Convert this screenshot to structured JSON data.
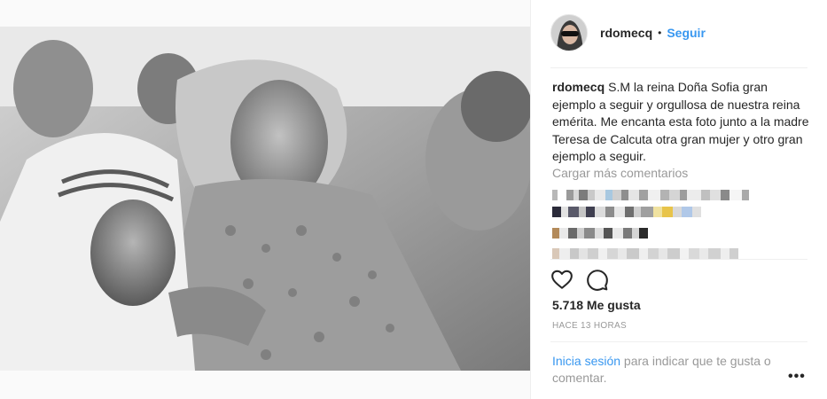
{
  "post": {
    "username": "rdomecq",
    "separator": "•",
    "follow_label": "Seguir",
    "caption_user": "rdomecq",
    "caption_text": "S.M la reina Doña Sofia gran ejemplo a seguir y orgullosa de nuestra reina emérita. Me encanta esta foto junto a la madre Teresa de Calcuta otra gran mujer y otro gran ejemplo a seguir.",
    "load_more_label": "Cargar más comentarios",
    "likes_text": "5.718 Me gusta",
    "timestamp": "HACE 13 HORAS",
    "login_link": "Inicia sesión",
    "login_text": " para indicar que te gusta o comentar.",
    "menu_label": "•••"
  },
  "icons": {
    "like": "heart-icon",
    "comment": "comment-icon",
    "more": "more-options-icon"
  },
  "colors": {
    "link_blue": "#3897f0",
    "text": "#262626",
    "muted": "#999999",
    "divider": "#efefef"
  }
}
